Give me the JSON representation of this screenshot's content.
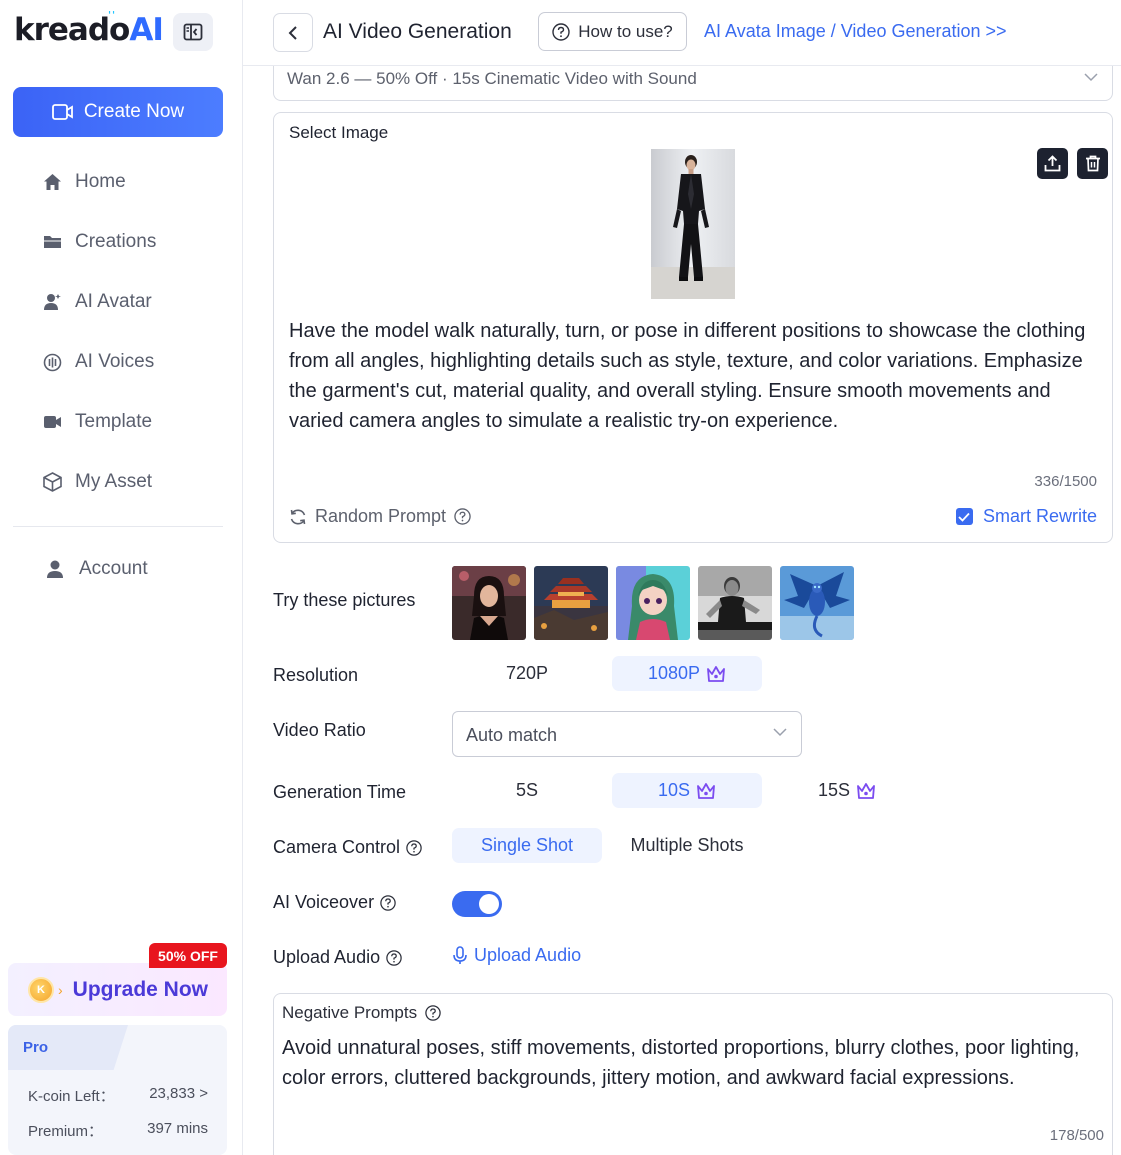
{
  "app": {
    "logo_text_main": "kreado",
    "logo_text_ai": "AI"
  },
  "sidebar": {
    "create_label": "Create Now",
    "items": [
      {
        "label": "Home",
        "icon": "home-icon"
      },
      {
        "label": "Creations",
        "icon": "folder-icon"
      },
      {
        "label": "AI Avatar",
        "icon": "avatar-icon"
      },
      {
        "label": "AI Voices",
        "icon": "voice-icon"
      },
      {
        "label": "Template",
        "icon": "video-template-icon"
      },
      {
        "label": "My Asset",
        "icon": "cube-icon"
      }
    ],
    "account_label": "Account",
    "upgrade_label": "Upgrade Now",
    "upgrade_badge": "50% OFF",
    "coin_letter": "K",
    "plan": {
      "name": "Pro",
      "kcoin_label": "K-coin Left：",
      "kcoin_value": "23,833 >",
      "premium_label": "Premium：",
      "premium_value": "397 mins"
    }
  },
  "header": {
    "title": "AI Video Generation",
    "howto_label": "How to use?",
    "link_label": "AI Avata Image / Video Generation >>"
  },
  "model_select": {
    "value": "Wan 2.6 — 50% Off · 15s Cinematic Video with Sound"
  },
  "image_card": {
    "label": "Select Image",
    "prompt": "Have the model walk naturally, turn, or pose in different positions to showcase the clothing from all angles, highlighting details such as style, texture, and color variations. Emphasize the garment's cut, material quality, and overall styling. Ensure smooth movements and varied camera angles to simulate a realistic try-on experience.",
    "counter": "336/1500",
    "random_label": "Random Prompt",
    "smart_label": "Smart Rewrite",
    "smart_checked": true
  },
  "samples": {
    "label": "Try these pictures",
    "items": [
      "portrait-woman",
      "pagoda-landscape",
      "anime-girl",
      "runner",
      "blue-dragon"
    ]
  },
  "resolution": {
    "label": "Resolution",
    "options": [
      {
        "label": "720P",
        "active": false,
        "premium": false
      },
      {
        "label": "1080P",
        "active": true,
        "premium": true
      }
    ]
  },
  "ratio": {
    "label": "Video Ratio",
    "value": "Auto match"
  },
  "gen_time": {
    "label": "Generation Time",
    "options": [
      {
        "label": "5S",
        "active": false,
        "premium": false
      },
      {
        "label": "10S",
        "active": true,
        "premium": true
      },
      {
        "label": "15S",
        "active": false,
        "premium": true
      }
    ]
  },
  "camera": {
    "label": "Camera Control",
    "options": [
      {
        "label": "Single Shot",
        "active": true
      },
      {
        "label": "Multiple Shots",
        "active": false
      }
    ]
  },
  "voiceover": {
    "label": "AI Voiceover",
    "enabled": true
  },
  "audio": {
    "label": "Upload Audio",
    "button_label": "Upload Audio"
  },
  "negative": {
    "label": "Negative Prompts",
    "text": "Avoid unnatural poses, stiff movements, distorted proportions, blurry clothes, poor lighting, color errors, cluttered backgrounds, jittery motion, and awkward facial expressions.",
    "counter": "178/500"
  },
  "colors": {
    "accent": "#3a6bf0",
    "premium_crown": "#7b4cf0",
    "badge_red": "#e8151e"
  }
}
